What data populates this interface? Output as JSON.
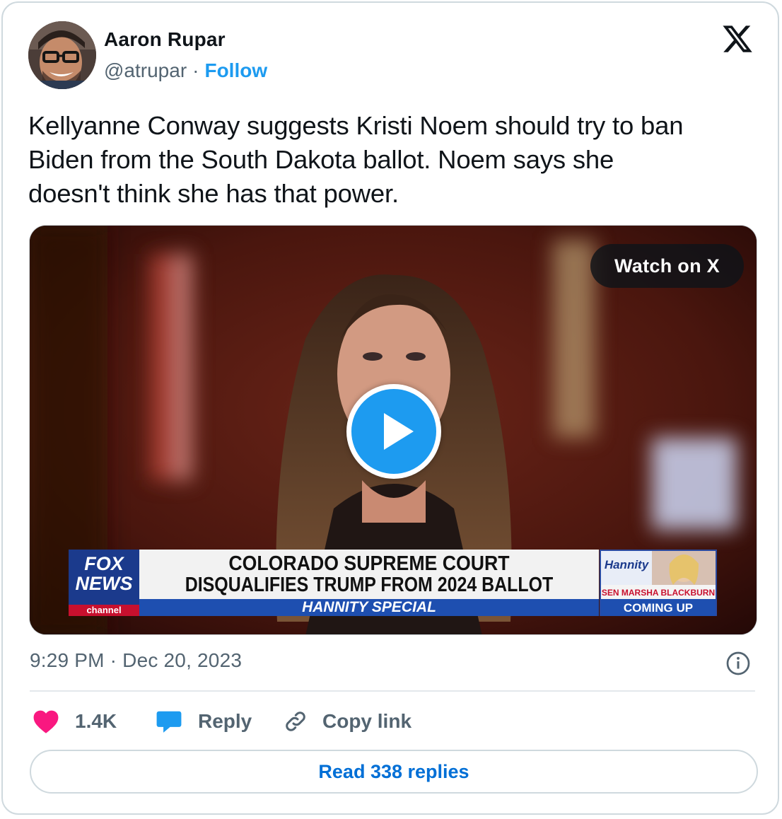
{
  "author": {
    "name": "Aaron Rupar",
    "handle": "@atrupar",
    "separator": "·",
    "follow_label": "Follow"
  },
  "tweet": {
    "text": "Kellyanne Conway suggests Kristi Noem should try to ban\nBiden from the South Dakota ballot. Noem says she\ndoesn't think she has that power."
  },
  "media": {
    "watch_label": "Watch on X",
    "lower_third": {
      "network_line1": "FOX",
      "network_line2": "NEWS",
      "network_line3": "channel",
      "headline_line1": "COLORADO SUPREME COURT",
      "headline_line2": "DISQUALIFIES TRUMP FROM 2024 BALLOT",
      "show_bar": "HANNITY SPECIAL",
      "promo_logo": "Hannity",
      "promo_line1": "SEN MARSHA BLACKBURN",
      "promo_line2": "COMING UP"
    }
  },
  "meta": {
    "timestamp": "9:29 PM · Dec 20, 2023"
  },
  "actions": {
    "like_count": "1.4K",
    "reply_label": "Reply",
    "copy_label": "Copy link",
    "read_replies_label": "Read 338 replies"
  },
  "colors": {
    "accent": "#1d9bf0",
    "like": "#f91880",
    "read_link": "#006fd6",
    "muted": "#536471",
    "border": "#cfd9de"
  },
  "icons": {
    "logo": "x-logo-icon",
    "play": "play-icon",
    "info": "info-icon",
    "like": "heart-icon",
    "reply": "speech-bubble-icon",
    "copy": "link-icon"
  }
}
